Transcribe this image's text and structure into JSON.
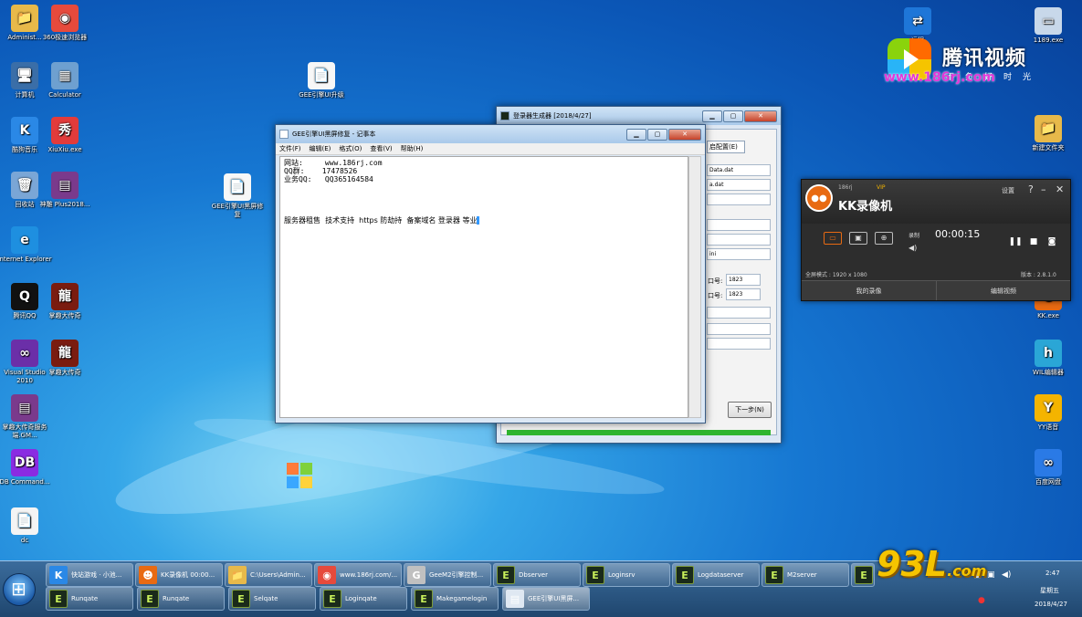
{
  "desktop_icons_left": [
    {
      "label": "Administ...",
      "glyph": "📁",
      "color": "#e7b94a"
    },
    {
      "label": "360极速浏览器",
      "glyph": "◉",
      "color": "#e64a3c"
    },
    {
      "label": "计算机",
      "glyph": "🖥",
      "color": "#3a6ea8"
    },
    {
      "label": "Calculator",
      "glyph": "▦",
      "color": "#6ea0d0"
    },
    {
      "label": "酷狗音乐",
      "glyph": "K",
      "color": "#2a88e6"
    },
    {
      "label": "XiuXiu.exe",
      "glyph": "秀",
      "color": "#e23b3b"
    },
    {
      "label": "回收站",
      "glyph": "🗑",
      "color": "#7aa6d6"
    },
    {
      "label": "神雕 Plus2018...",
      "glyph": "▤",
      "color": "#7a3a8c"
    },
    {
      "label": "Internet Explorer",
      "glyph": "e",
      "color": "#1e8fe0"
    },
    {
      "label": "腾讯QQ",
      "glyph": "Q",
      "color": "#111"
    },
    {
      "label": "掌趣大传奇",
      "glyph": "龍",
      "color": "#7a1c10"
    },
    {
      "label": "Visual Studio 2010",
      "glyph": "∞",
      "color": "#6b2fa8"
    },
    {
      "label": "掌趣大传奇",
      "glyph": "龍",
      "color": "#7a1c10"
    },
    {
      "label": "掌趣大传奇服务端.GM...",
      "glyph": "▤",
      "color": "#7a3a8c"
    },
    {
      "label": "DB Command...",
      "glyph": "DB",
      "color": "#8a2be2"
    },
    {
      "label": "dc",
      "glyph": "📄",
      "color": "#ffffff"
    }
  ],
  "desktop_icons_center": [
    {
      "label": "GEE引擎UI升级"
    },
    {
      "label": "GEE引擎UI黑屏修复"
    }
  ],
  "desktop_icons_right": [
    {
      "label": "远程",
      "glyph": "⇄",
      "color": "#1e76d8"
    },
    {
      "label": "1189.exe",
      "glyph": "▭",
      "color": "#c8d8ea"
    },
    {
      "label": "新建文件夹",
      "glyph": "📁",
      "color": "#e7b94a"
    },
    {
      "label": "KK.exe",
      "glyph": "☻",
      "color": "#e86a12"
    },
    {
      "label": "WIL编辑器",
      "glyph": "h",
      "color": "#2aa6d6"
    },
    {
      "label": "YY语音",
      "glyph": "Y",
      "color": "#f4b400"
    },
    {
      "label": "百度网盘",
      "glyph": "∞",
      "color": "#2a7ae6"
    }
  ],
  "notepad": {
    "title": "GEE引擎UI黑屏修复 - 记事本",
    "menu": [
      "文件(F)",
      "编辑(E)",
      "格式(O)",
      "查看(V)",
      "帮助(H)"
    ],
    "lines": [
      "网站:     www.186rj.com",
      "QQ群:    17478526",
      "业务QQ:   QQ365164584"
    ],
    "services": "服务器租售  技术支持  https 防劫持  备案域名 登录器 等业"
  },
  "generator": {
    "title": "登录器生成器 [2018/4/27]",
    "tab": "启配置(E)",
    "fields": [
      "Data.dat",
      "a.dat",
      "",
      "",
      "",
      "ini",
      "",
      "",
      ""
    ],
    "port_label": "口号:",
    "port_values": [
      "1823",
      "1823"
    ],
    "next_button": "下一步(N)"
  },
  "kk": {
    "user": "186rj",
    "vip": "VIP",
    "title": "KK录像机",
    "settings": "设置",
    "rec_label": "录制",
    "time": "00:00:15",
    "resolution": "全屏模式 : 1920 x 1080",
    "version": "版本 : 2.8.1.0",
    "my_videos": "我的录像",
    "edit_video": "编辑视频"
  },
  "watermarks": {
    "tencent_name": "腾讯视频",
    "slogan": "不负好时光",
    "site": "www.186rj.com",
    "wm93": "93L",
    "wm93_sub": ".com"
  },
  "taskbar": {
    "row1": [
      {
        "label": "快站游戏 · 小池...",
        "glyph": "K",
        "color": "#2a88e6"
      },
      {
        "label": "KK录像机 00:00...",
        "glyph": "☻",
        "color": "#e86a12"
      },
      {
        "label": "C:\\Users\\Admin...",
        "glyph": "📁",
        "color": "#e7b94a"
      },
      {
        "label": "www.186rj.com/...",
        "glyph": "◉",
        "color": "#e64a3c"
      },
      {
        "label": "GeeM2引擎控制...",
        "glyph": "G",
        "color": "#c0c0c0"
      },
      {
        "label": "Dbserver",
        "glyph": "E",
        "color": "e"
      },
      {
        "label": "Loginsrv",
        "glyph": "E",
        "color": "e"
      },
      {
        "label": "Logdataserver",
        "glyph": "E",
        "color": "e"
      },
      {
        "label": "M2server",
        "glyph": "E",
        "color": "e"
      },
      {
        "label": "",
        "glyph": "E",
        "color": "e"
      }
    ],
    "row2": [
      {
        "label": "Runqate",
        "glyph": "E",
        "color": "e"
      },
      {
        "label": "Runqate",
        "glyph": "E",
        "color": "e"
      },
      {
        "label": "Selqate",
        "glyph": "E",
        "color": "e"
      },
      {
        "label": "Loginqate",
        "glyph": "E",
        "color": "e"
      },
      {
        "label": "Makegamelogin",
        "glyph": "E",
        "color": "e"
      },
      {
        "label": "GEE引擎UI黑屏...",
        "glyph": "▤",
        "color": "#dfe8f2"
      }
    ],
    "clock_time": "2:47",
    "clock_day": "星期五",
    "clock_date": "2018/4/27"
  }
}
